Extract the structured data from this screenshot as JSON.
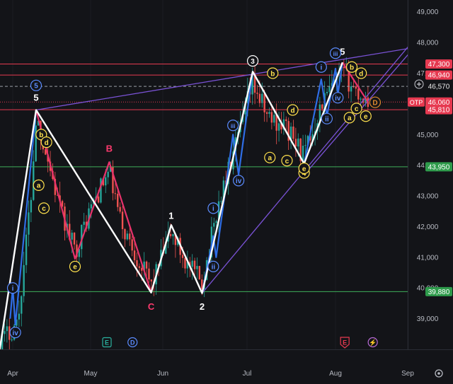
{
  "chart_data": {
    "type": "candlestick",
    "x_axis": {
      "ticks": [
        "Apr",
        "May",
        "Jun",
        "Jul",
        "Aug",
        "Sep"
      ]
    },
    "y_axis": {
      "ticks": [
        "39,000",
        "40,000",
        "41,000",
        "42,000",
        "43,000",
        "44,000",
        "45,000",
        "46,000",
        "47,000",
        "48,000",
        "49,000"
      ],
      "ylim": [
        38000,
        49200
      ]
    },
    "price_labels": [
      {
        "text": "47,300",
        "value": 47300,
        "bg": "#e63950",
        "fg": "#ffffff"
      },
      {
        "text": "46,950",
        "value": 46950,
        "bg": "none",
        "fg": "#e8e8e8"
      },
      {
        "text": "46,940",
        "value": 46940,
        "bg": "#e63950",
        "fg": "#ffffff"
      },
      {
        "text": "46,570",
        "value": 46570,
        "bg": "none",
        "fg": "#e8e8e8"
      },
      {
        "text": "46,060",
        "value": 46060,
        "bg": "#e63950",
        "fg": "#ffffff"
      },
      {
        "text": "45,810",
        "value": 45810,
        "bg": "#e63950",
        "fg": "#ffffff"
      },
      {
        "text": "43,950",
        "value": 43950,
        "bg": "#2e9b4b",
        "fg": "#ffffff"
      },
      {
        "text": "39,880",
        "value": 39880,
        "bg": "#2e9b4b",
        "fg": "#ffffff"
      }
    ],
    "otp_label": "OTP",
    "horizontal_lines": [
      {
        "value": 47300,
        "color": "#e63950",
        "style": "solid"
      },
      {
        "value": 46940,
        "color": "#e63950",
        "style": "solid"
      },
      {
        "value": 46570,
        "color": "#9aa0a6",
        "style": "dashed"
      },
      {
        "value": 46060,
        "color": "#e63950",
        "style": "dotted"
      },
      {
        "value": 45810,
        "color": "#e63950",
        "style": "solid"
      },
      {
        "value": 43950,
        "color": "#3fae5a",
        "style": "solid"
      },
      {
        "value": 39880,
        "color": "#3fae5a",
        "style": "solid"
      }
    ],
    "primary_wave": [
      {
        "date": "2024-03-27",
        "value": 38000
      },
      {
        "date": "2024-04-10",
        "value": 45800
      },
      {
        "date": "2024-05-27",
        "value": 39850
      },
      {
        "date": "2024-06-04",
        "value": 42050
      },
      {
        "date": "2024-06-15",
        "value": 39830
      },
      {
        "date": "2024-07-03",
        "value": 47050
      },
      {
        "date": "2024-07-21",
        "value": 44050
      },
      {
        "date": "2024-08-04",
        "value": 47350
      }
    ],
    "abc_wave": [
      {
        "date": "2024-04-10",
        "value": 45800
      },
      {
        "date": "2024-04-25",
        "value": 40950
      },
      {
        "date": "2024-05-09",
        "value": 44100
      },
      {
        "date": "2024-05-27",
        "value": 39850
      }
    ],
    "final_wave": [
      {
        "date": "2024-08-04",
        "value": 47350
      },
      {
        "date": "2024-08-15",
        "value": 46050
      }
    ],
    "impulse_subwaves": [
      [
        {
          "date": "2024-03-31",
          "value": 39000
        },
        {
          "date": "2024-04-01",
          "value": 40000
        },
        {
          "date": "2024-04-02",
          "value": 38800
        },
        {
          "date": "2024-04-10",
          "value": 45800
        }
      ],
      [
        {
          "date": "2024-06-15",
          "value": 39830
        },
        {
          "date": "2024-06-19",
          "value": 41700
        },
        {
          "date": "2024-06-20",
          "value": 41000
        },
        {
          "date": "2024-06-26",
          "value": 45000
        },
        {
          "date": "2024-06-28",
          "value": 43700
        },
        {
          "date": "2024-07-03",
          "value": 47050
        }
      ],
      [
        {
          "date": "2024-07-21",
          "value": 44050
        },
        {
          "date": "2024-07-27",
          "value": 46800
        },
        {
          "date": "2024-07-29",
          "value": 45600
        },
        {
          "date": "2024-08-01",
          "value": 47150
        },
        {
          "date": "2024-08-02",
          "value": 46300
        },
        {
          "date": "2024-08-04",
          "value": 47350
        }
      ]
    ],
    "trend_lines": [
      {
        "from": {
          "date": "2024-04-10",
          "value": 45800
        },
        "to": {
          "date": "2024-09-17",
          "value": 48000
        }
      },
      {
        "from": {
          "date": "2024-06-15",
          "value": 39830
        },
        "to": {
          "date": "2024-09-17",
          "value": 49300
        }
      },
      {
        "from": {
          "date": "2024-07-23",
          "value": 43900
        },
        "to": {
          "date": "2024-09-17",
          "value": 49000
        }
      }
    ],
    "wave_labels": [
      {
        "text": "5",
        "date": "2024-04-10",
        "value": 46200,
        "color": "#ffffff",
        "circle": false
      },
      {
        "text": "5",
        "date": "2024-04-10",
        "value": 46600,
        "color": "#5b8cff",
        "circle": true
      },
      {
        "text": "B",
        "date": "2024-05-09",
        "value": 44550,
        "color": "#ff3a6e",
        "circle": false
      },
      {
        "text": "C",
        "date": "2024-05-27",
        "value": 39400,
        "color": "#ff3a6e",
        "circle": false
      },
      {
        "text": "1",
        "date": "2024-06-04",
        "value": 42350,
        "color": "#ffffff",
        "circle": false
      },
      {
        "text": "2",
        "date": "2024-06-15",
        "value": 39400,
        "color": "#ffffff",
        "circle": false
      },
      {
        "text": "3",
        "date": "2024-07-03",
        "value": 47400,
        "color": "#ffffff",
        "circle": true
      },
      {
        "text": "4",
        "date": "2024-07-21",
        "value": 43750,
        "color": "#ffe14d",
        "circle": true
      },
      {
        "text": "5",
        "date": "2024-08-04",
        "value": 47700,
        "color": "#ffffff",
        "circle": false
      },
      {
        "text": "iii",
        "date": "2024-08-01",
        "value": 47650,
        "color": "#5b8cff",
        "circle": true
      },
      {
        "text": "i",
        "date": "2024-07-27",
        "value": 47200,
        "color": "#5b8cff",
        "circle": true
      },
      {
        "text": "ii",
        "date": "2024-07-29",
        "value": 45520,
        "color": "#5b8cff",
        "circle": true
      },
      {
        "text": "iv",
        "date": "2024-08-02",
        "value": 46200,
        "color": "#5b8cff",
        "circle": true
      },
      {
        "text": "iii",
        "date": "2024-06-26",
        "value": 45300,
        "color": "#5b8cff",
        "circle": true
      },
      {
        "text": "iv",
        "date": "2024-06-28",
        "value": 43500,
        "color": "#5b8cff",
        "circle": true
      },
      {
        "text": "i",
        "date": "2024-06-19",
        "value": 42600,
        "color": "#5b8cff",
        "circle": true
      },
      {
        "text": "ii",
        "date": "2024-06-19",
        "value": 40700,
        "color": "#5b8cff",
        "circle": true
      },
      {
        "text": "i",
        "date": "2024-04-01",
        "value": 40000,
        "color": "#5b8cff",
        "circle": true
      },
      {
        "text": "iv",
        "date": "2024-04-02",
        "value": 38550,
        "color": "#5b8cff",
        "circle": true
      },
      {
        "text": "b",
        "date": "2024-04-12",
        "value": 45000,
        "color": "#ffe14d",
        "circle": true
      },
      {
        "text": "d",
        "date": "2024-04-14",
        "value": 44750,
        "color": "#ffe14d",
        "circle": true
      },
      {
        "text": "a",
        "date": "2024-04-11",
        "value": 43350,
        "color": "#ffe14d",
        "circle": true
      },
      {
        "text": "c",
        "date": "2024-04-13",
        "value": 42600,
        "color": "#ffe14d",
        "circle": true
      },
      {
        "text": "e",
        "date": "2024-04-25",
        "value": 40700,
        "color": "#ffe14d",
        "circle": true
      },
      {
        "text": "b",
        "date": "2024-07-10",
        "value": 47000,
        "color": "#ffe14d",
        "circle": true
      },
      {
        "text": "d",
        "date": "2024-07-17",
        "value": 45800,
        "color": "#ffe14d",
        "circle": true
      },
      {
        "text": "a",
        "date": "2024-07-09",
        "value": 44250,
        "color": "#ffe14d",
        "circle": true
      },
      {
        "text": "c",
        "date": "2024-07-15",
        "value": 44150,
        "color": "#ffe14d",
        "circle": true
      },
      {
        "text": "e",
        "date": "2024-07-21",
        "value": 43900,
        "color": "#ffe14d",
        "circle": true
      },
      {
        "text": "b",
        "date": "2024-08-08",
        "value": 47200,
        "color": "#ffe14d",
        "circle": true
      },
      {
        "text": "d",
        "date": "2024-08-12",
        "value": 47000,
        "color": "#ffe14d",
        "circle": true
      },
      {
        "text": "c",
        "date": "2024-08-10",
        "value": 45850,
        "color": "#ffe14d",
        "circle": true
      },
      {
        "text": "a",
        "date": "2024-08-07",
        "value": 45550,
        "color": "#ffe14d",
        "circle": true
      },
      {
        "text": "e",
        "date": "2024-08-14",
        "value": 45600,
        "color": "#ffe14d",
        "circle": true
      },
      {
        "text": "D",
        "date": "2024-08-18",
        "value": 46050,
        "color": "#e08a2e",
        "circle": true
      }
    ],
    "markers": [
      {
        "text": "E",
        "date": "2024-05-08",
        "color": "#2bb3a0",
        "shape": "square"
      },
      {
        "text": "D",
        "date": "2024-05-19",
        "color": "#5b8cff",
        "shape": "circle"
      },
      {
        "text": "E",
        "date": "2024-08-05",
        "color": "#e63950",
        "shape": "shield"
      },
      {
        "text": "⚡",
        "date": "2024-08-17",
        "color": "#b86bd6",
        "shape": "circle"
      }
    ],
    "grid": false,
    "background": "#131418"
  }
}
